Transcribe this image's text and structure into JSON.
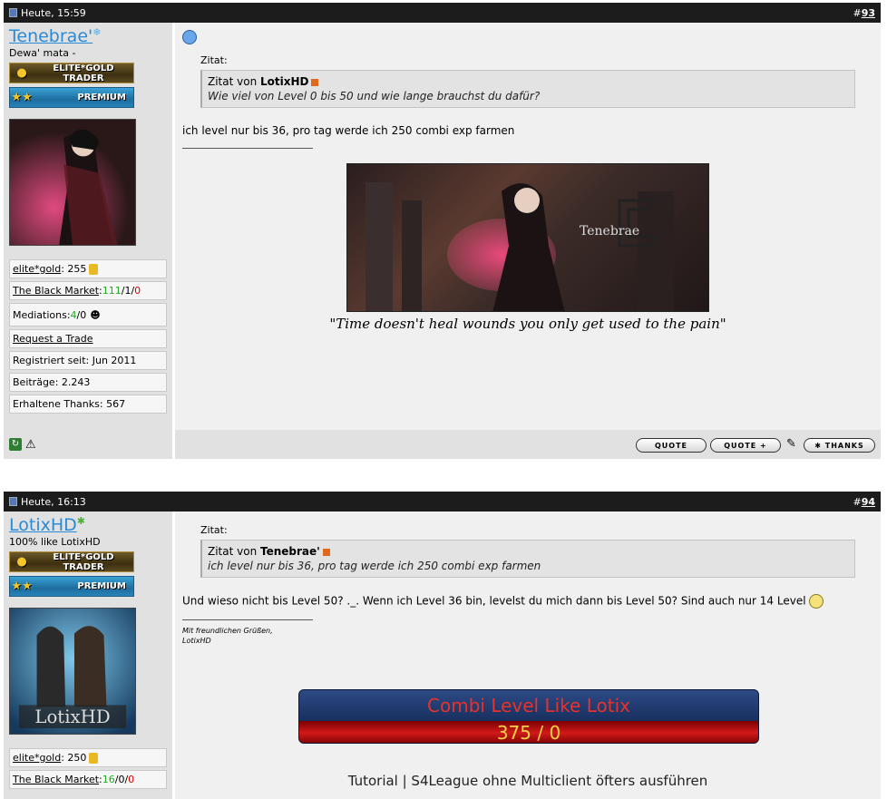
{
  "posts": [
    {
      "header": {
        "time": "Heute, 15:59",
        "hash": "#",
        "number": "93"
      },
      "user": {
        "name": "Tenebrae'",
        "title": "Dewa' mata -"
      },
      "badges": {
        "gold": "ELITE*GOLD TRADER",
        "premium": "PREMIUM"
      },
      "avatar": {
        "alt": "Tenebrae avatar"
      },
      "info": {
        "elitegold_label": "elite*gold",
        "elitegold_value": ": 255",
        "market_label": "The Black Market",
        "market_sep": ": ",
        "market_g": "111",
        "market_mid": "/1/",
        "market_r": "0",
        "mediations": "Mediations: ",
        "med_g": "4",
        "med_rest": "/0",
        "request": "Request a Trade",
        "registered": "Registriert seit: Jun 2011",
        "posts": "Beiträge: 2.243",
        "thanks": "Erhaltene Thanks: 567"
      },
      "quote": {
        "label": "Zitat:",
        "by_prefix": "Zitat von ",
        "author": "LotixHD",
        "text": "Wie viel von Level 0 bis 50 und wie lange brauchst du dafür?"
      },
      "message": "ich level nur bis 36, pro tag werde ich 250 combi exp farmen",
      "banner_text": "Tenebrae",
      "signature_quote": "\"Time doesn't heal wounds you only get used to the pain\"",
      "buttons": {
        "quote": "QUOTE",
        "quote_plus": "QUOTE +",
        "thanks": "THANKS"
      }
    },
    {
      "header": {
        "time": "Heute, 16:13",
        "hash": "#",
        "number": "94"
      },
      "user": {
        "name": "LotixHD",
        "title": "100% like LotixHD"
      },
      "badges": {
        "gold": "ELITE*GOLD TRADER",
        "premium": "PREMIUM"
      },
      "info": {
        "elitegold_label": "elite*gold",
        "elitegold_value": ": 250",
        "market_label": "The Black Market",
        "market_sep": ": ",
        "market_g": "16",
        "market_mid": "/0/",
        "market_r": "0"
      },
      "quote": {
        "label": "Zitat:",
        "by_prefix": "Zitat von ",
        "author": "Tenebrae'",
        "text": "ich level nur bis 36, pro tag werde ich 250 combi exp farmen"
      },
      "message": "Und wieso nicht bis Level 50? ._. Wenn ich Level 36 bin, levelst du mich dann bis Level 50? Sind auch nur 14 Level",
      "signature": {
        "line1": "Mit freundlichen Grüßen,",
        "line2": "LotixHD"
      },
      "level_banner": {
        "title": "Combi Level Like Lotix",
        "value": "375 / 0"
      },
      "tutorial": "Tutorial | S4League ohne Multiclient öfters ausführen"
    }
  ],
  "colors": {
    "header": "#1c1c1c",
    "sidebar": "#e1e1e1",
    "content": "#f0f0f0",
    "username": "#2a8ad6",
    "green": "#22aa22",
    "red": "#dd0000"
  },
  "icons": [
    "post-icon",
    "snowflake-icon",
    "star-icon",
    "coin-icon",
    "stars-icon",
    "user-icon",
    "skype-icon",
    "refresh-icon",
    "warning-icon",
    "smiley-icon",
    "quote-link-icon",
    "edit-icon",
    "asterisk-icon"
  ]
}
